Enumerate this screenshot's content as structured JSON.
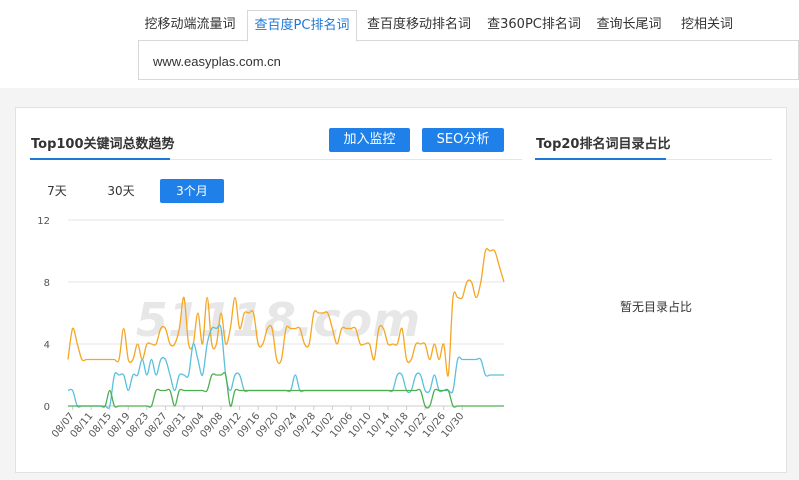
{
  "tabs": [
    {
      "label": "挖移动端流量词"
    },
    {
      "label": "查百度PC排名词",
      "active": true
    },
    {
      "label": "查百度移动排名词"
    },
    {
      "label": "查360PC排名词"
    },
    {
      "label": "查询长尾词"
    },
    {
      "label": "挖相关词"
    }
  ],
  "search": {
    "value": "www.easyplas.com.cn"
  },
  "trend": {
    "title": "Top100关键词总数趋势",
    "monitor_button": "加入监控",
    "seo_button": "SEO分析",
    "ranges": [
      "7天",
      "30天",
      "3个月"
    ],
    "active_range": "3个月"
  },
  "ratio": {
    "title": "Top20排名词目录占比",
    "empty_text": "暂无目录占比"
  },
  "watermark": "51118.com",
  "chart_data": {
    "type": "line",
    "ylim": [
      0,
      12
    ],
    "yticks": [
      0,
      4,
      8,
      12
    ],
    "grid": true,
    "xticks": [
      "08/07",
      "08/11",
      "08/15",
      "08/19",
      "08/23",
      "08/27",
      "08/31",
      "09/04",
      "09/08",
      "09/12",
      "09/16",
      "09/20",
      "09/24",
      "09/28",
      "10/02",
      "10/06",
      "10/10",
      "10/14",
      "10/18",
      "10/22",
      "10/26",
      "10/30"
    ],
    "x_start": "08/06",
    "series": [
      {
        "color": "#f5a623",
        "values": [
          3,
          5,
          4,
          3,
          3,
          3,
          3,
          3,
          3,
          3,
          3,
          3,
          5,
          3,
          3,
          4,
          3,
          4,
          4,
          4,
          5,
          5,
          4,
          4,
          5,
          7,
          4,
          4,
          6,
          4,
          7,
          4,
          4,
          6,
          4,
          5,
          7,
          5,
          6,
          6,
          6,
          4,
          4,
          5,
          5,
          3,
          3,
          5,
          5,
          5,
          5,
          4,
          4,
          6,
          6,
          6,
          6,
          5,
          4,
          5,
          5,
          5,
          5,
          4,
          4,
          4,
          3,
          5,
          5,
          4,
          4,
          4,
          5,
          3,
          3,
          4,
          4,
          4,
          3,
          4,
          3,
          4,
          2,
          7,
          7,
          7,
          8,
          8,
          7,
          8,
          10,
          10,
          10,
          9,
          8
        ]
      },
      {
        "color": "#5bc0de",
        "values": [
          1,
          1,
          0,
          0,
          0,
          0,
          0,
          0,
          0,
          0,
          2,
          2,
          2,
          1,
          2,
          2,
          3,
          2,
          3,
          2,
          3,
          3,
          2,
          1,
          2,
          2,
          2,
          4,
          3,
          2,
          4,
          5,
          5,
          5,
          2,
          1,
          2,
          2,
          1,
          1,
          1,
          1,
          1,
          1,
          1,
          1,
          1,
          1,
          1,
          2,
          1,
          1,
          1,
          1,
          1,
          1,
          1,
          1,
          1,
          1,
          1,
          1,
          1,
          1,
          1,
          1,
          1,
          1,
          1,
          1,
          1,
          2,
          2,
          1,
          1,
          2,
          2,
          1,
          1,
          2,
          1,
          1,
          1,
          1,
          3,
          3,
          3,
          3,
          3,
          3,
          2,
          2,
          2,
          2,
          2
        ]
      },
      {
        "color": "#4caf50",
        "values": [
          0,
          0,
          0,
          0,
          0,
          0,
          0,
          0,
          0,
          1,
          0,
          0,
          0,
          0,
          0,
          0,
          0,
          0,
          0,
          1,
          1,
          1,
          1,
          0,
          1,
          1,
          1,
          1,
          1,
          1,
          1,
          2,
          2,
          2,
          2,
          0,
          1,
          1,
          1,
          1,
          1,
          1,
          1,
          1,
          1,
          1,
          1,
          1,
          1,
          1,
          1,
          1,
          1,
          1,
          1,
          1,
          1,
          1,
          1,
          1,
          1,
          1,
          1,
          1,
          1,
          1,
          1,
          1,
          1,
          1,
          1,
          1,
          1,
          1,
          1,
          1,
          1,
          0,
          0,
          1,
          1,
          1,
          1,
          0,
          0,
          0,
          0,
          0,
          0,
          0,
          0,
          0,
          0,
          0,
          0
        ]
      }
    ]
  }
}
